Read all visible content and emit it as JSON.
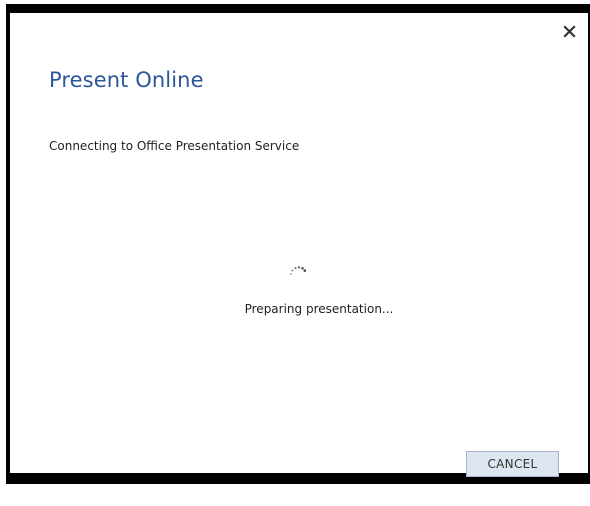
{
  "dialog": {
    "title": "Present Online",
    "status_message": "Connecting to Office Presentation Service",
    "progress_message": "Preparing presentation...",
    "cancel_label": "CANCEL"
  },
  "icons": {
    "close": "close-icon",
    "spinner": "loading-spinner-icon"
  },
  "colors": {
    "title": "#2b579a",
    "button_bg": "#dde6f0",
    "button_border": "#a6b6c8",
    "frame": "#000000"
  }
}
